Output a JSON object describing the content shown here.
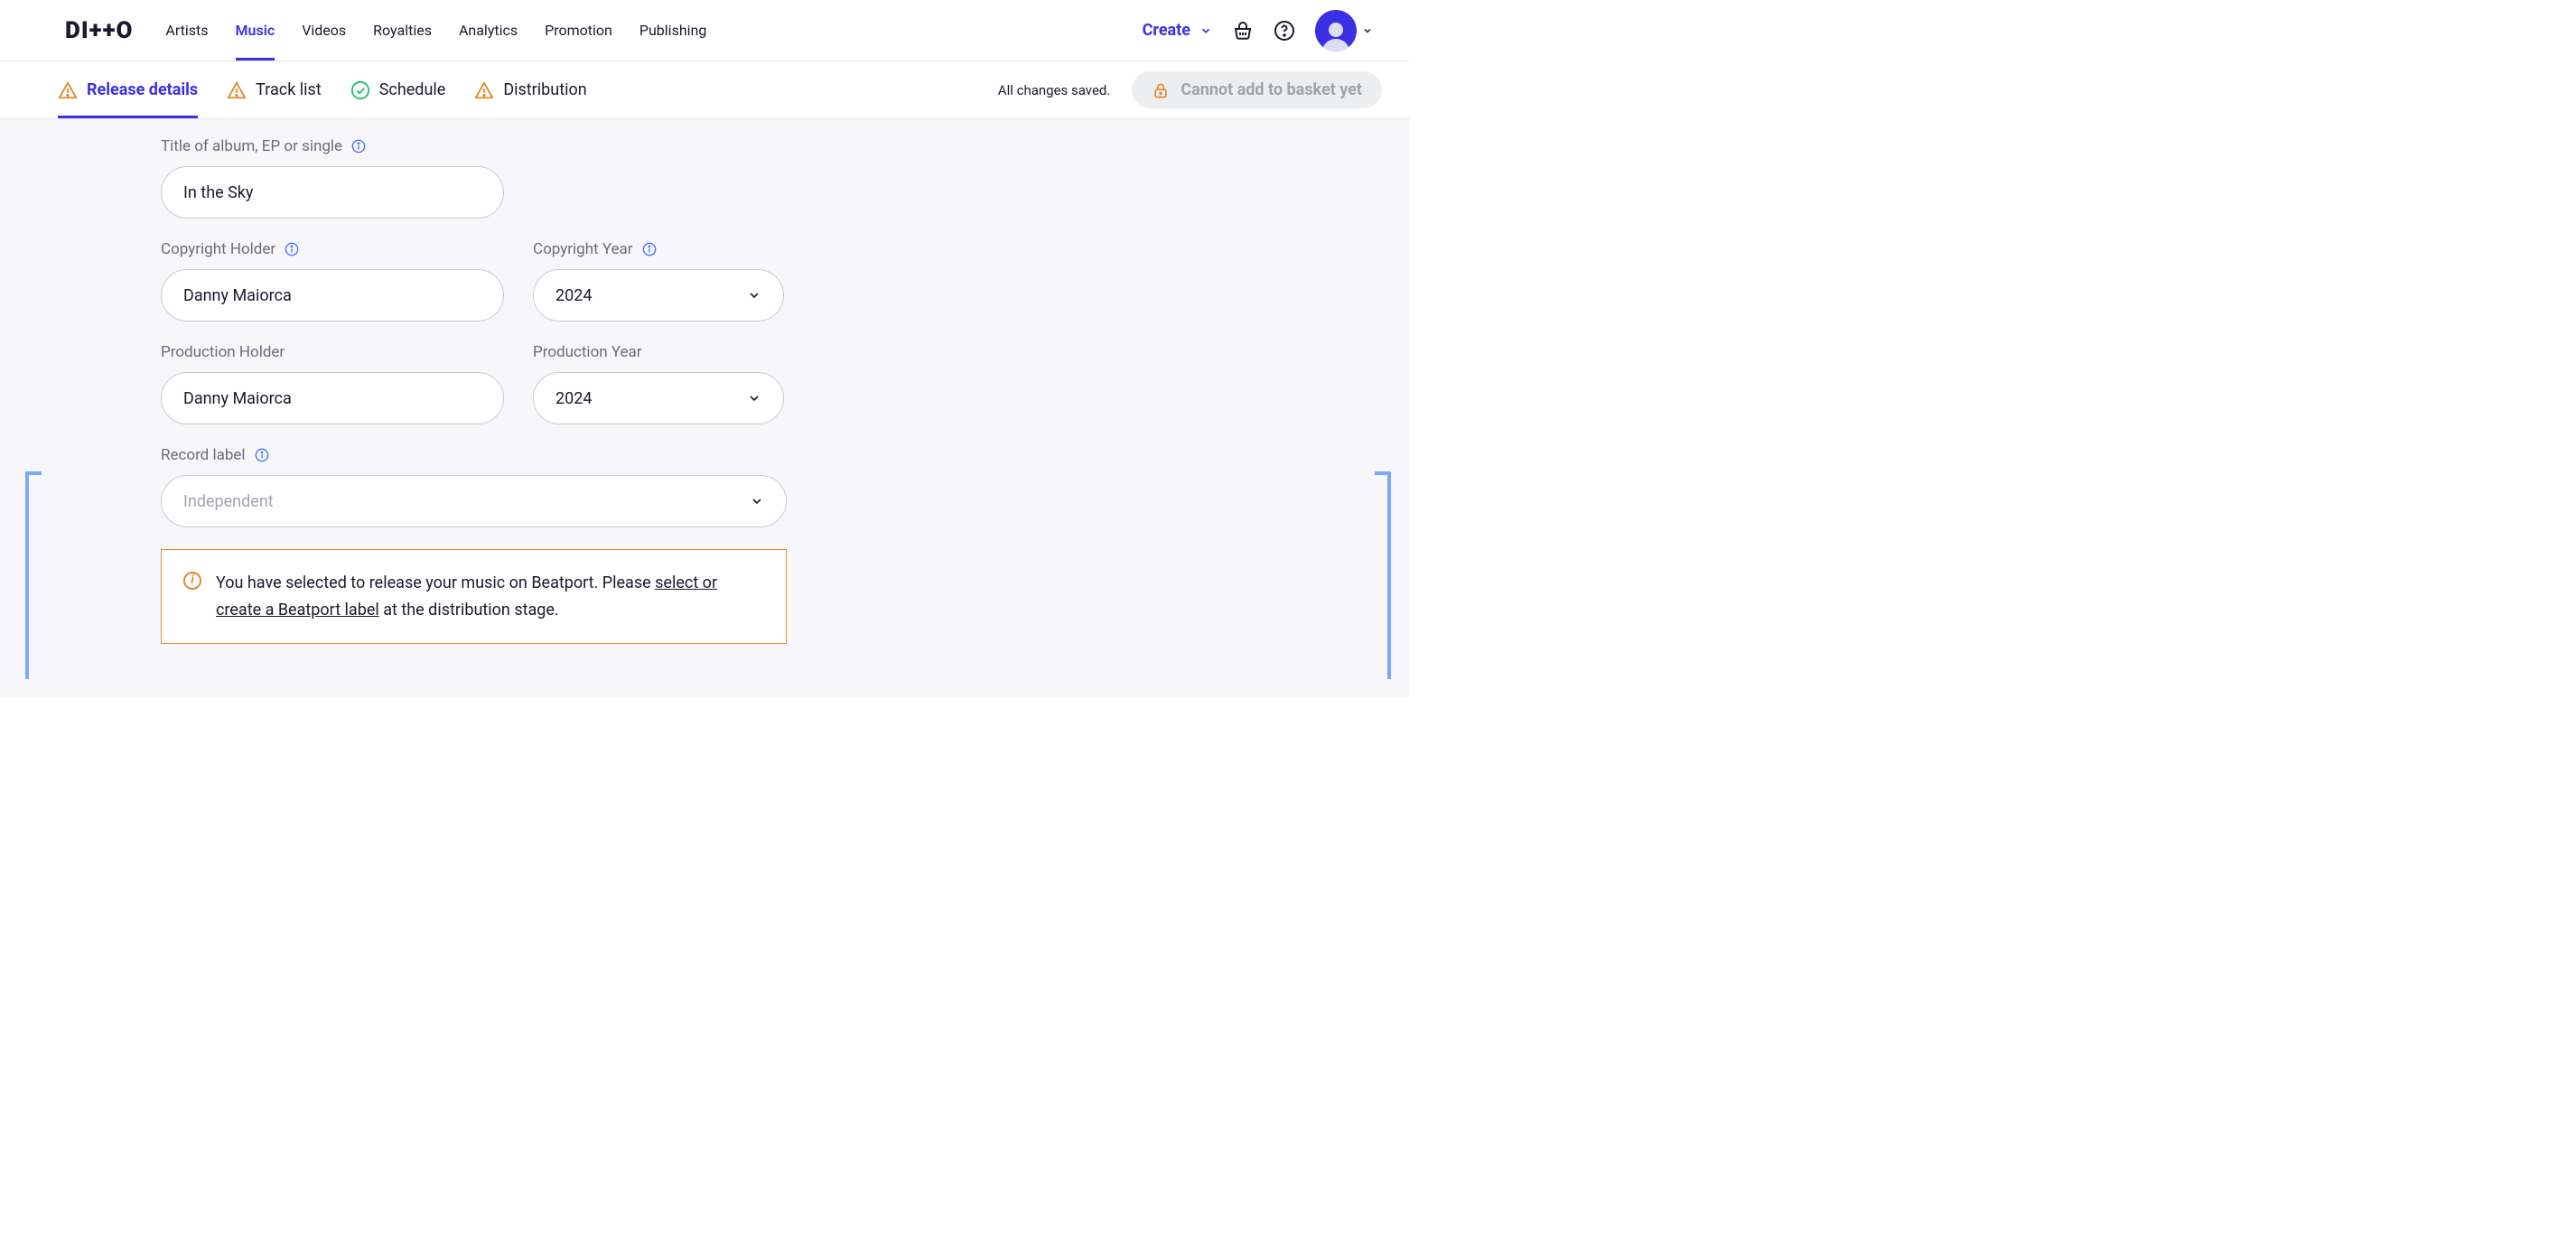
{
  "logo": "DI++O",
  "nav": {
    "items": [
      {
        "label": "Artists",
        "active": false
      },
      {
        "label": "Music",
        "active": true
      },
      {
        "label": "Videos",
        "active": false
      },
      {
        "label": "Royalties",
        "active": false
      },
      {
        "label": "Analytics",
        "active": false
      },
      {
        "label": "Promotion",
        "active": false
      },
      {
        "label": "Publishing",
        "active": false
      }
    ],
    "create_label": "Create"
  },
  "subtabs": {
    "items": [
      {
        "label": "Release details",
        "status": "warn",
        "active": true
      },
      {
        "label": "Track list",
        "status": "warn",
        "active": false
      },
      {
        "label": "Schedule",
        "status": "ok",
        "active": false
      },
      {
        "label": "Distribution",
        "status": "warn",
        "active": false
      }
    ],
    "save_status": "All changes saved.",
    "basket_label": "Cannot add to basket yet"
  },
  "form": {
    "title_label": "Title of album, EP or single",
    "title_value": "In the Sky",
    "copyright_holder_label": "Copyright Holder",
    "copyright_holder_value": "Danny Maiorca",
    "copyright_year_label": "Copyright Year",
    "copyright_year_value": "2024",
    "production_holder_label": "Production Holder",
    "production_holder_value": "Danny Maiorca",
    "production_year_label": "Production Year",
    "production_year_value": "2024",
    "record_label_label": "Record label",
    "record_label_placeholder": "Independent",
    "notice_pre": "You have selected to release your music on Beatport. Please ",
    "notice_link": "select or create a Beatport label",
    "notice_post": " at the distribution stage."
  }
}
